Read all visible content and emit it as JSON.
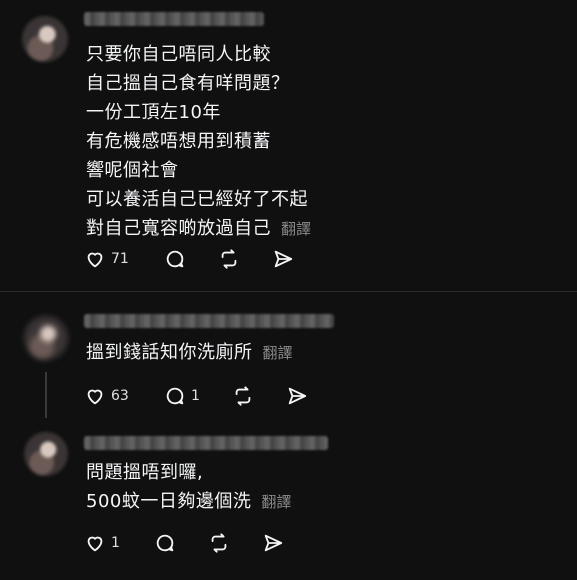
{
  "comments": [
    {
      "lines": [
        "只要你自己唔同人比較",
        "自己搵自己食有咩問題？",
        "一份工頂左10年",
        "有危機感唔想用到積蓄",
        "響呢個社會",
        "可以養活自己已經好了不起",
        "對自己寬容啲放過自己"
      ],
      "translate_label": "翻譯",
      "likes": "71",
      "replies": ""
    },
    {
      "lines": [
        "搵到錢話知你洗廁所"
      ],
      "translate_label": "翻譯",
      "likes": "63",
      "replies": "1"
    },
    {
      "lines": [
        "問題搵唔到囉,",
        "500蚊一日夠邊個洗"
      ],
      "translate_label": "翻譯",
      "likes": "1",
      "replies": ""
    }
  ],
  "icons": [
    "heart-icon",
    "comment-icon",
    "repost-icon",
    "share-icon"
  ]
}
